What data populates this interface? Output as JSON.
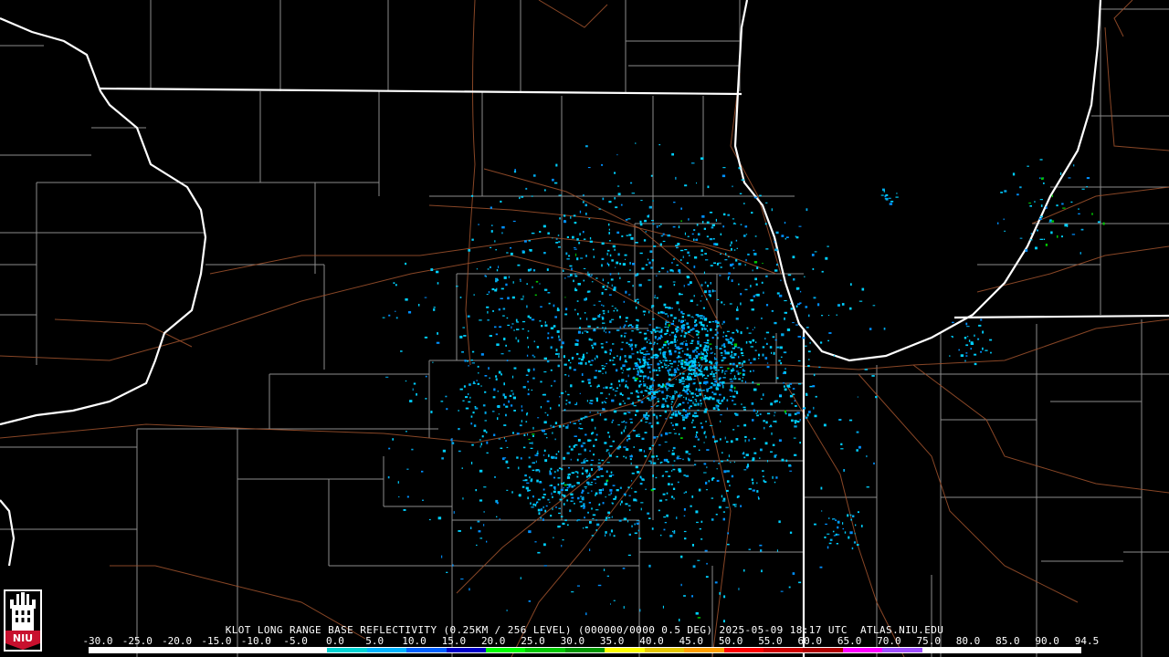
{
  "title": "KLOT LONG RANGE BASE REFLECTIVITY (0.25KM / 256 LEVEL) (000000/0000 0.5 DEG) 2025-05-09 18:17 UTC  ATLAS.NIU.EDU",
  "logo": {
    "text": "NIU",
    "colors": {
      "banner": "#c8102e",
      "tower": "#ffffff"
    }
  },
  "scale": {
    "labels": [
      "-30.0",
      "-25.0",
      "-20.0",
      "-15.0",
      "-10.0",
      "-5.0",
      "0.0",
      "5.0",
      "10.0",
      "15.0",
      "20.0",
      "25.0",
      "30.0",
      "35.0",
      "40.0",
      "45.0",
      "50.0",
      "55.0",
      "60.0",
      "65.0",
      "70.0",
      "75.0",
      "80.0",
      "85.0",
      "90.0",
      "94.5"
    ],
    "colors": [
      "#ffffff",
      "#ffffff",
      "#ffffff",
      "#ffffff",
      "#ffffff",
      "#ffffff",
      "#00d4d4",
      "#00b4ff",
      "#0060ff",
      "#0000c8",
      "#00ff00",
      "#00c800",
      "#009600",
      "#ffff00",
      "#e6c800",
      "#ffa000",
      "#ff0000",
      "#d00000",
      "#b00000",
      "#ff00ff",
      "#a050ff",
      "#ffffff",
      "#ffffff",
      "#ffffff",
      "#ffffff"
    ]
  },
  "map": {
    "radar_site": "KLOT",
    "colors": {
      "state_border": "#ffffff",
      "county_line": "#8c8c8c",
      "highway": "#a0522d",
      "echo_light": "#00d0ff",
      "echo_mid": "#0090ff",
      "echo_green": "#00c800"
    }
  }
}
